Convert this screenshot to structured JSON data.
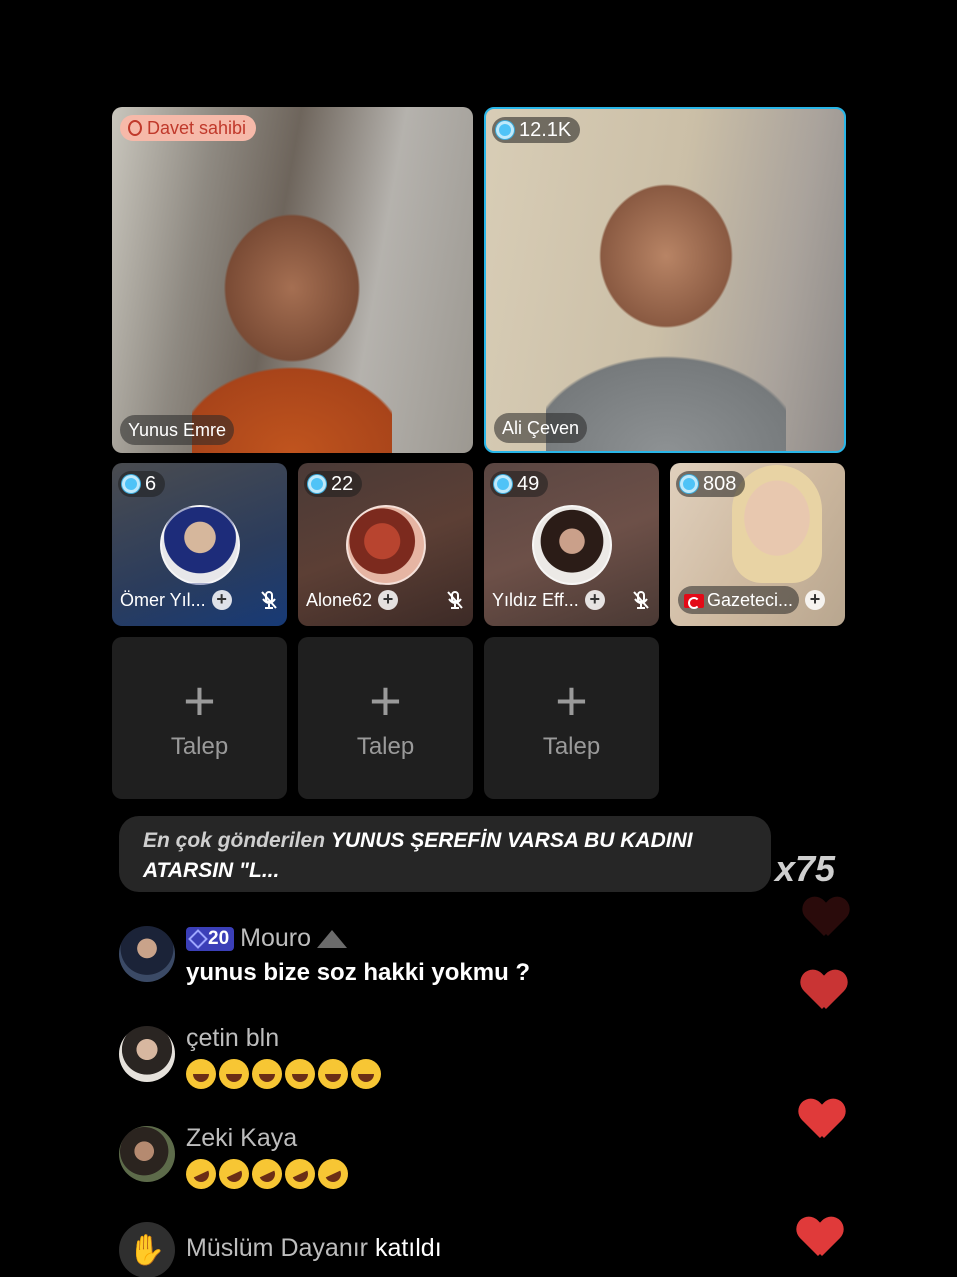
{
  "stage": {
    "host": {
      "badge": "Davet sahibi",
      "name": "Yunus Emre"
    },
    "guest": {
      "count": "12.1K",
      "name": "Ali Çeven"
    }
  },
  "participants": [
    {
      "count": "6",
      "name": "Ömer Yıl...",
      "muted": true
    },
    {
      "count": "22",
      "name": "Alone62",
      "muted": true
    },
    {
      "count": "49",
      "name": "Yıldız Eff...",
      "muted": true
    },
    {
      "count": "808",
      "name": "Gazeteci...",
      "muted": false,
      "flag": "turkey-flag"
    }
  ],
  "requests": [
    {
      "plus": "+",
      "label": "Talep"
    },
    {
      "plus": "+",
      "label": "Talep"
    },
    {
      "plus": "+",
      "label": "Talep"
    }
  ],
  "top_gift": {
    "lead": "En çok gönderilen",
    "message": "YUNUS ŞEREFİN VARSA BU KADINI ATARSIN \"L...",
    "multiplier": "x75"
  },
  "comments": [
    {
      "level": "20",
      "user": "Mouro",
      "text": "yunus bize soz hakki yokmu ?"
    },
    {
      "user": "çetin bln",
      "emoji_count": 6,
      "emoji": "joy"
    },
    {
      "user": "Zeki Kaya",
      "emoji_count": 5,
      "emoji": "rofl"
    }
  ],
  "join_event": {
    "user": "Müslüm Dayanır",
    "action": "katıldı"
  },
  "colors": {
    "accent_border": "#29b6e8",
    "heart": "#e03a3a",
    "host_badge": "#f6b9a9"
  }
}
